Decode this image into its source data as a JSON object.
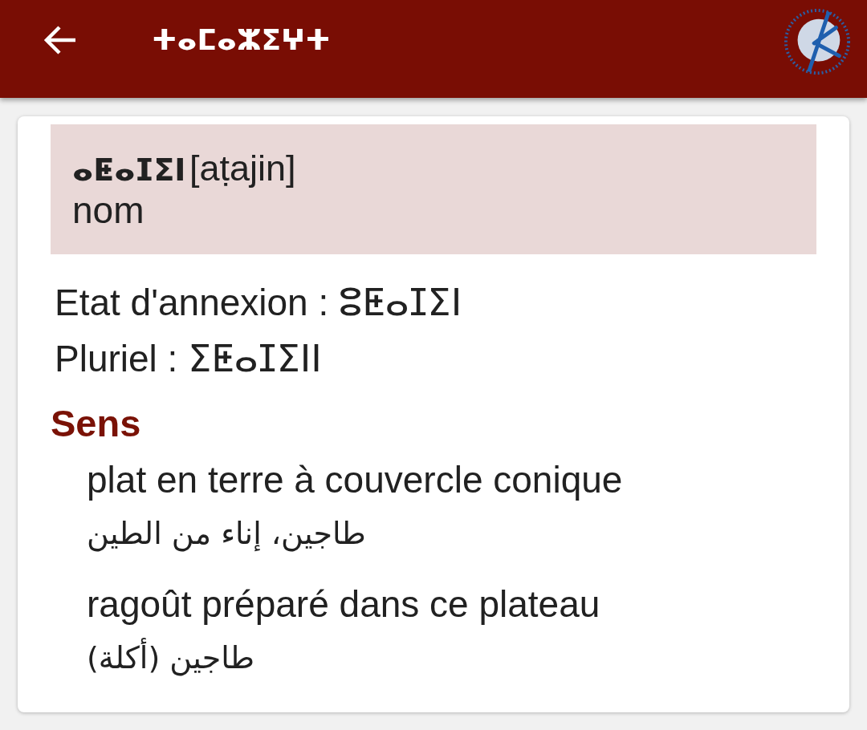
{
  "app_bar": {
    "title": "ⵜⴰⵎⴰⵣⵉⵖⵜ"
  },
  "entry": {
    "headword": "ⴰⵟⴰⵊⵉⵏ",
    "transcription": "[aṭajin]",
    "category": "nom",
    "forms": [
      "Etat d'annexion : ⵓⵟⴰⵊⵉⵏ",
      "Pluriel : ⵉⵟⴰⵊⵉⵏⵏ"
    ],
    "senses_heading": "Sens",
    "senses": [
      {
        "french": "plat en terre à couvercle conique",
        "arabic": "طاجين، إناء من الطين"
      },
      {
        "french": "ragoût préparé dans ce plateau",
        "arabic": "طاجين (أكلة)"
      }
    ]
  }
}
